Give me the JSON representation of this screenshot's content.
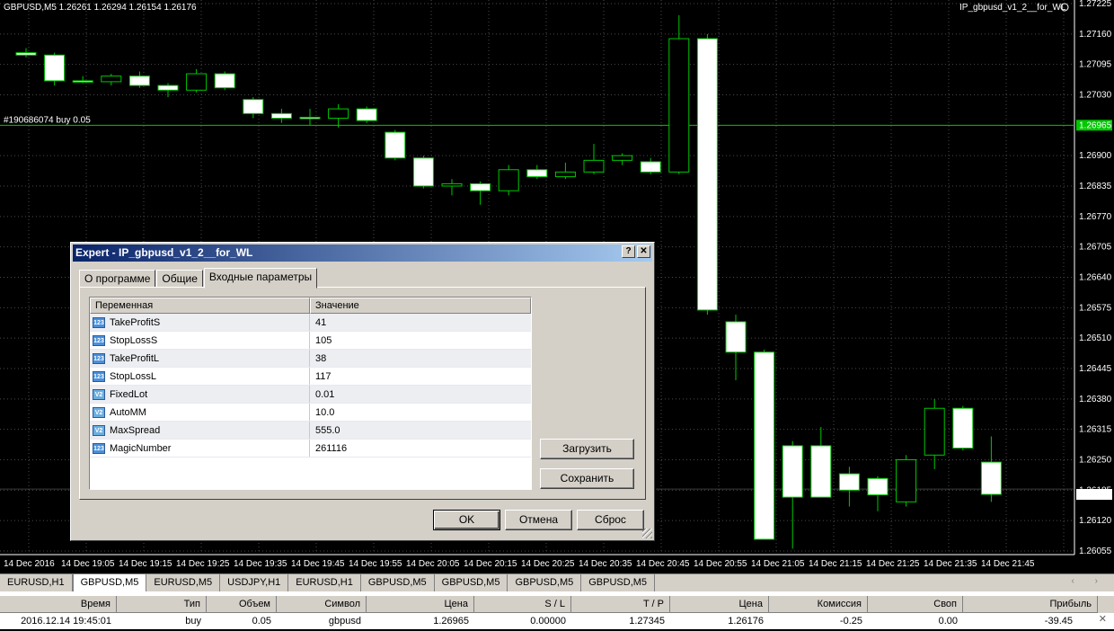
{
  "chart": {
    "header": "GBPUSD,M5  1.26261 1.26294 1.26154 1.26176",
    "ea_label": "IP_gbpusd_v1_2__for_WL",
    "order_label": "#190686074 buy 0.05",
    "order_price": 1.26965,
    "current_price": 1.26176,
    "price_labels": [
      "1.27225",
      "1.27160",
      "1.27095",
      "1.27030",
      "1.26965",
      "1.26900",
      "1.26835",
      "1.26770",
      "1.26705",
      "1.26640",
      "1.26575",
      "1.26510",
      "1.26445",
      "1.26380",
      "1.26315",
      "1.26250",
      "1.26185",
      "1.26176",
      "1.26120",
      "1.26055"
    ],
    "time_labels": [
      "14 Dec 2016",
      "14 Dec 19:05",
      "14 Dec 19:15",
      "14 Dec 19:25",
      "14 Dec 19:35",
      "14 Dec 19:45",
      "14 Dec 19:55",
      "14 Dec 20:05",
      "14 Dec 20:15",
      "14 Dec 20:25",
      "14 Dec 20:35",
      "14 Dec 20:45",
      "14 Dec 20:55",
      "14 Dec 21:05",
      "14 Dec 21:15",
      "14 Dec 21:25",
      "14 Dec 21:35",
      "14 Dec 21:45"
    ],
    "colors": {
      "bull": "#000000",
      "bear": "#ffffff",
      "outline": "#00c800",
      "grid": "#4a4a4a",
      "order_line": "#00c800",
      "price_tag_bg": "#00c800"
    }
  },
  "chart_data": {
    "type": "candlestick",
    "ylim": [
      1.26055,
      1.27225
    ],
    "candles": [
      {
        "o": 1.2712,
        "h": 1.2713,
        "l": 1.2711,
        "c": 1.27115
      },
      {
        "o": 1.27115,
        "h": 1.2712,
        "l": 1.2705,
        "c": 1.2706
      },
      {
        "o": 1.2706,
        "h": 1.2707,
        "l": 1.27055,
        "c": 1.27058
      },
      {
        "o": 1.27058,
        "h": 1.27075,
        "l": 1.2705,
        "c": 1.2707
      },
      {
        "o": 1.2707,
        "h": 1.2708,
        "l": 1.27045,
        "c": 1.2705
      },
      {
        "o": 1.2705,
        "h": 1.27055,
        "l": 1.27025,
        "c": 1.2704
      },
      {
        "o": 1.2704,
        "h": 1.27085,
        "l": 1.27035,
        "c": 1.27075
      },
      {
        "o": 1.27075,
        "h": 1.2708,
        "l": 1.2704,
        "c": 1.27045
      },
      {
        "o": 1.2702,
        "h": 1.27025,
        "l": 1.2698,
        "c": 1.2699
      },
      {
        "o": 1.2699,
        "h": 1.27,
        "l": 1.2697,
        "c": 1.2698
      },
      {
        "o": 1.26982,
        "h": 1.27,
        "l": 1.26965,
        "c": 1.2698
      },
      {
        "o": 1.2698,
        "h": 1.2701,
        "l": 1.2696,
        "c": 1.27
      },
      {
        "o": 1.27,
        "h": 1.27005,
        "l": 1.2697,
        "c": 1.26975
      },
      {
        "o": 1.2695,
        "h": 1.26955,
        "l": 1.2689,
        "c": 1.26895
      },
      {
        "o": 1.26895,
        "h": 1.269,
        "l": 1.2683,
        "c": 1.26835
      },
      {
        "o": 1.26835,
        "h": 1.2685,
        "l": 1.26815,
        "c": 1.2684
      },
      {
        "o": 1.2684,
        "h": 1.26845,
        "l": 1.26795,
        "c": 1.26825
      },
      {
        "o": 1.26825,
        "h": 1.2688,
        "l": 1.26815,
        "c": 1.2687
      },
      {
        "o": 1.2687,
        "h": 1.2688,
        "l": 1.2685,
        "c": 1.26855
      },
      {
        "o": 1.26855,
        "h": 1.26885,
        "l": 1.2685,
        "c": 1.26865
      },
      {
        "o": 1.26865,
        "h": 1.26925,
        "l": 1.2686,
        "c": 1.2689
      },
      {
        "o": 1.2689,
        "h": 1.26905,
        "l": 1.2688,
        "c": 1.269
      },
      {
        "o": 1.26887,
        "h": 1.26895,
        "l": 1.2686,
        "c": 1.26865
      },
      {
        "o": 1.26865,
        "h": 1.272,
        "l": 1.2686,
        "c": 1.2715
      },
      {
        "o": 1.2715,
        "h": 1.2716,
        "l": 1.2656,
        "c": 1.2657
      },
      {
        "o": 1.26545,
        "h": 1.2656,
        "l": 1.2642,
        "c": 1.2648
      },
      {
        "o": 1.2648,
        "h": 1.26485,
        "l": 1.2612,
        "c": 1.2608
      },
      {
        "o": 1.2628,
        "h": 1.2629,
        "l": 1.2606,
        "c": 1.2617
      },
      {
        "o": 1.2628,
        "h": 1.2632,
        "l": 1.2622,
        "c": 1.2617
      },
      {
        "o": 1.2622,
        "h": 1.26235,
        "l": 1.2615,
        "c": 1.26185
      },
      {
        "o": 1.2621,
        "h": 1.26215,
        "l": 1.2614,
        "c": 1.26175
      },
      {
        "o": 1.2616,
        "h": 1.2626,
        "l": 1.2615,
        "c": 1.2625
      },
      {
        "o": 1.2626,
        "h": 1.2638,
        "l": 1.2623,
        "c": 1.2636
      },
      {
        "o": 1.2636,
        "h": 1.26365,
        "l": 1.2627,
        "c": 1.26275
      },
      {
        "o": 1.26245,
        "h": 1.263,
        "l": 1.2616,
        "c": 1.26176
      }
    ]
  },
  "dialog": {
    "title": "Expert - IP_gbpusd_v1_2__for_WL",
    "help_glyph": "?",
    "close_glyph": "✕",
    "tabs": [
      "О программе",
      "Общие",
      "Входные параметры"
    ],
    "active_tab": 2,
    "grid_headers": [
      "Переменная",
      "Значение"
    ],
    "params": [
      {
        "name": "TakeProfitS",
        "value": "41",
        "icon": "123"
      },
      {
        "name": "StopLossS",
        "value": "105",
        "icon": "123"
      },
      {
        "name": "TakeProfitL",
        "value": "38",
        "icon": "123"
      },
      {
        "name": "StopLossL",
        "value": "117",
        "icon": "123"
      },
      {
        "name": "FixedLot",
        "value": "0.01",
        "icon": "V2"
      },
      {
        "name": "AutoMM",
        "value": "10.0",
        "icon": "V2"
      },
      {
        "name": "MaxSpread",
        "value": "555.0",
        "icon": "V2"
      },
      {
        "name": "MagicNumber",
        "value": "261116",
        "icon": "123"
      }
    ],
    "load_label": "Загрузить",
    "save_label": "Сохранить",
    "ok_label": "OK",
    "cancel_label": "Отмена",
    "reset_label": "Сброс"
  },
  "tabbar": {
    "tabs": [
      "EURUSD,H1",
      "GBPUSD,M5",
      "EURUSD,M5",
      "USDJPY,H1",
      "EURUSD,H1",
      "GBPUSD,M5",
      "GBPUSD,M5",
      "GBPUSD,M5",
      "GBPUSD,M5"
    ],
    "active": 1,
    "arrows": "‹ ›"
  },
  "terminal": {
    "headers": [
      "Время",
      "Тип",
      "Объем",
      "Символ",
      "Цена",
      "S / L",
      "T / P",
      "Цена",
      "Комиссия",
      "Своп",
      "Прибыль"
    ],
    "row": [
      "2016.12.14 19:45:01",
      "buy",
      "0.05",
      "gbpusd",
      "1.26965",
      "0.00000",
      "1.27345",
      "1.26176",
      "-0.25",
      "0.00",
      "-39.45"
    ],
    "close_glyph": "✕"
  }
}
